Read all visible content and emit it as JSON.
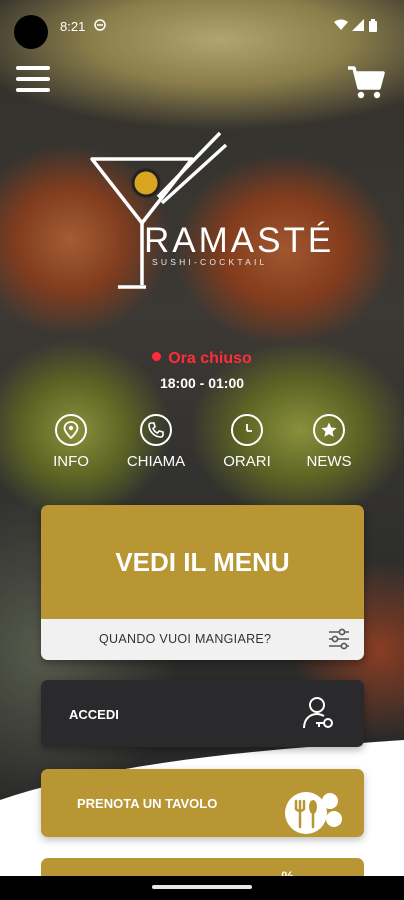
{
  "status_bar": {
    "time": "8:21"
  },
  "brand": {
    "name": "RAMASTÉ",
    "tagline": "SUSHI-COCKTAIL"
  },
  "status": {
    "open_state": "Ora chiuso",
    "hours": "18:00 - 01:00"
  },
  "quick_actions": [
    {
      "label": "INFO",
      "icon": "location-pin-icon"
    },
    {
      "label": "CHIAMA",
      "icon": "phone-icon"
    },
    {
      "label": "ORARI",
      "icon": "clock-icon"
    },
    {
      "label": "NEWS",
      "icon": "star-badge-icon"
    }
  ],
  "menu_card": {
    "title": "VEDI IL MENU",
    "when_label": "QUANDO VUOI MANGIARE?"
  },
  "login_button": {
    "label": "ACCEDI"
  },
  "reserve_button": {
    "label": "PRENOTA UN TAVOLO"
  },
  "next_card": {
    "badge": "%"
  },
  "colors": {
    "accent_gold": "#b89634",
    "dark_button": "#2a2a2c",
    "closed_red": "#ff2d3a",
    "white": "#ffffff"
  }
}
